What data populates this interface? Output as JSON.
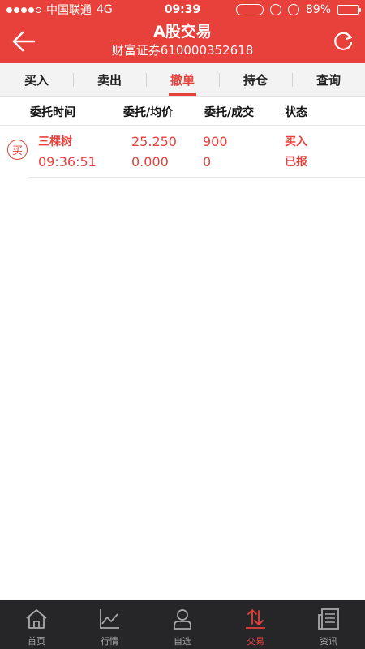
{
  "status_bar": {
    "carrier": "中国联通",
    "network": "4G",
    "time": "09:39",
    "battery": "89%",
    "battery_level": 0.89
  },
  "header": {
    "title": "A股交易",
    "subtitle": "财富证券610000352618"
  },
  "tabs": [
    {
      "label": "买入"
    },
    {
      "label": "卖出"
    },
    {
      "label": "撤单",
      "active": true
    },
    {
      "label": "持仓"
    },
    {
      "label": "查询"
    }
  ],
  "table": {
    "headers": {
      "time": "委托时间",
      "price": "委托/均价",
      "volume": "委托/成交",
      "status": "状态"
    },
    "rows": [
      {
        "badge": "买",
        "name": "三棵树",
        "time": "09:36:51",
        "order_price": "25.250",
        "avg_price": "0.000",
        "order_volume": "900",
        "filled_volume": "0",
        "direction": "买入",
        "status": "已报"
      }
    ]
  },
  "bottom_nav": [
    {
      "label": "首页",
      "icon": "home-icon"
    },
    {
      "label": "行情",
      "icon": "chart-icon"
    },
    {
      "label": "自选",
      "icon": "user-icon"
    },
    {
      "label": "交易",
      "icon": "trade-arrows-icon",
      "active": true
    },
    {
      "label": "资讯",
      "icon": "news-icon"
    }
  ],
  "colors": {
    "accent": "#e8403a",
    "nav_bg": "#262629",
    "nav_inactive": "#a8a8a8"
  }
}
